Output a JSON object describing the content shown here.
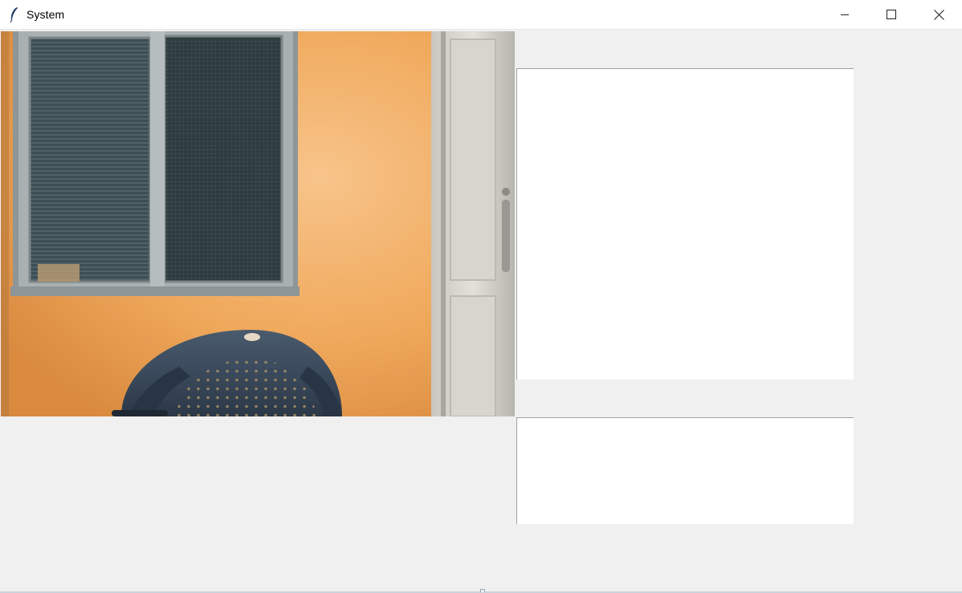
{
  "window": {
    "title": "System",
    "controls": {
      "minimize_icon": "minimize-icon",
      "maximize_icon": "maximize-icon",
      "close_icon": "close-icon"
    }
  },
  "camera": {
    "description_icon": "camera-feed"
  },
  "panels": {
    "top_textbox_value": "",
    "bottom_textbox_value": ""
  },
  "colors": {
    "background": "#f0f0f0",
    "titlebar": "#ffffff",
    "wall": "#f0a85a"
  }
}
